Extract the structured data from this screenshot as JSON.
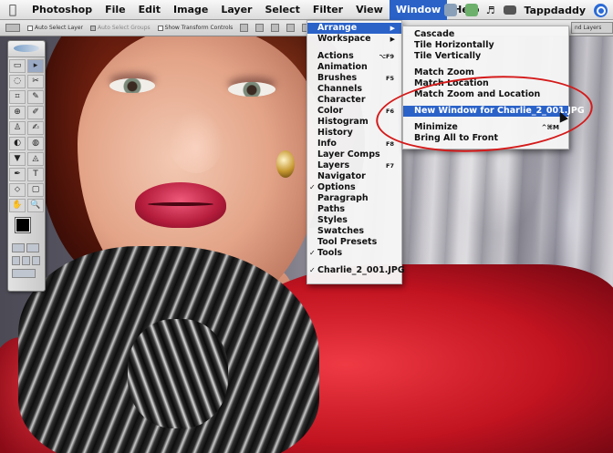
{
  "menubar": {
    "app_name": "Photoshop",
    "items": [
      "File",
      "Edit",
      "Image",
      "Layer",
      "Select",
      "Filter",
      "View",
      "Window",
      "Help"
    ],
    "open_menu": "Window",
    "user": "Tappdaddy"
  },
  "options_bar": {
    "auto_select_layer": "Auto Select Layer",
    "auto_select_groups": "Auto Select Groups",
    "show_transform_controls": "Show Transform Controls",
    "right_tab": "nd Layers"
  },
  "window_menu": {
    "items": [
      {
        "label": "Arrange",
        "arrow": "▶",
        "highlight": true
      },
      {
        "label": "Workspace",
        "arrow": "▶"
      },
      {
        "sep": true
      },
      {
        "label": "Actions",
        "shortcut": "⌥F9"
      },
      {
        "label": "Animation"
      },
      {
        "label": "Brushes",
        "shortcut": "F5"
      },
      {
        "label": "Channels"
      },
      {
        "label": "Character"
      },
      {
        "label": "Color",
        "shortcut": "F6"
      },
      {
        "label": "Histogram"
      },
      {
        "label": "History"
      },
      {
        "label": "Info",
        "shortcut": "F8"
      },
      {
        "label": "Layer Comps"
      },
      {
        "label": "Layers",
        "shortcut": "F7"
      },
      {
        "label": "Navigator"
      },
      {
        "label": "Options",
        "check": "✓"
      },
      {
        "label": "Paragraph"
      },
      {
        "label": "Paths"
      },
      {
        "label": "Styles"
      },
      {
        "label": "Swatches"
      },
      {
        "label": "Tool Presets"
      },
      {
        "label": "Tools",
        "check": "✓"
      },
      {
        "sep": true
      },
      {
        "label": "Charlie_2_001.JPG",
        "check": "✓"
      }
    ]
  },
  "arrange_menu": {
    "items": [
      {
        "label": "Cascade"
      },
      {
        "label": "Tile Horizontally"
      },
      {
        "label": "Tile Vertically"
      },
      {
        "sep": true
      },
      {
        "label": "Match Zoom"
      },
      {
        "label": "Match Location"
      },
      {
        "label": "Match Zoom and Location"
      },
      {
        "sep": true
      },
      {
        "label": "New Window for Charlie_2_001.JPG",
        "highlight": true
      },
      {
        "sep": true
      },
      {
        "label": "Minimize",
        "shortcut": "^⌘M"
      },
      {
        "label": "Bring All to Front"
      }
    ]
  },
  "tools": [
    "▭",
    "▸",
    "◌",
    "✂",
    "⌗",
    "✎",
    "⊕",
    "✐",
    "♙",
    "✍",
    "◐",
    "◍",
    "▼",
    "◬",
    "✒",
    "T",
    "⬦",
    "▢",
    "✋",
    "🔍"
  ],
  "colors": {
    "menu_highlight": "#2a62c8",
    "annotation": "#d51a1a"
  }
}
